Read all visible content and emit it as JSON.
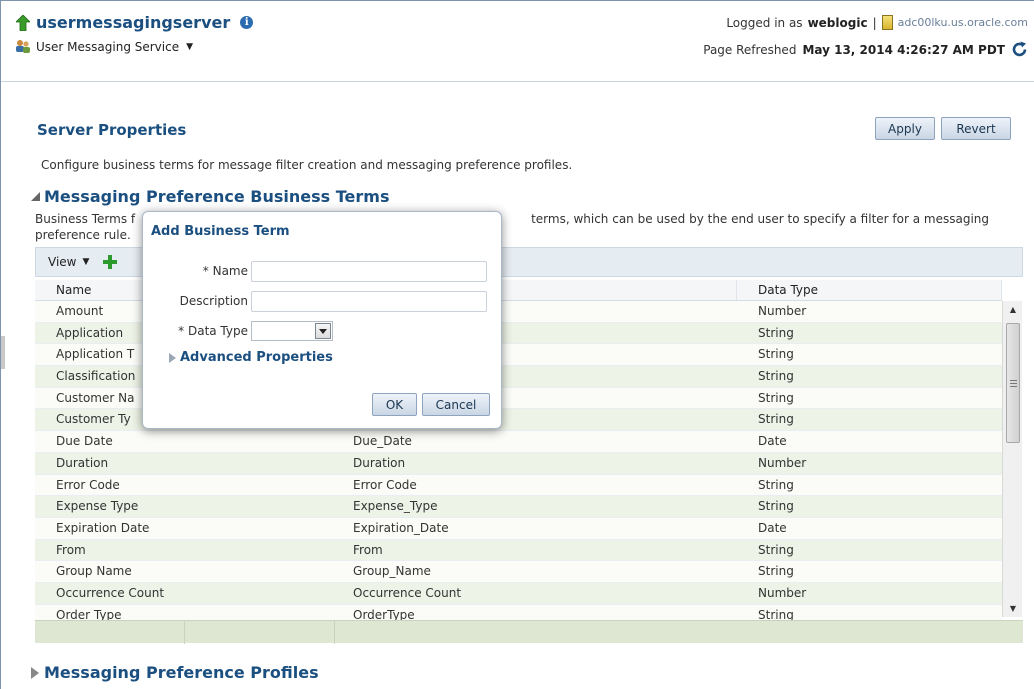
{
  "header": {
    "app_name": "usermessagingserver",
    "menu_label": "User Messaging Service",
    "logged_in_prefix": "Logged in as",
    "user": "weblogic",
    "separator": "|",
    "host": "adc00lku.us.oracle.com",
    "refreshed_prefix": "Page Refreshed",
    "refreshed_time": "May 13, 2014 4:26:27 AM PDT"
  },
  "server_properties": {
    "title": "Server Properties",
    "apply_label": "Apply",
    "revert_label": "Revert",
    "description": "Configure business terms for message filter creation and messaging preference profiles."
  },
  "business_terms": {
    "title": "Messaging Preference Business Terms",
    "description_left": "Business Terms f",
    "description_right": "terms, which can be used by the end user to specify a filter for a messaging",
    "description_line2": "preference rule.",
    "toolbar": {
      "view_label": "View"
    },
    "columns": [
      "Name",
      "",
      "Data Type"
    ],
    "rows": [
      {
        "name": "Amount",
        "key": "",
        "type": "Number"
      },
      {
        "name": "Application",
        "key": "",
        "type": "String"
      },
      {
        "name": "Application T",
        "key": "",
        "type": "String"
      },
      {
        "name": "Classification",
        "key": "",
        "type": "String"
      },
      {
        "name": "Customer Na",
        "key": "",
        "type": "String"
      },
      {
        "name": "Customer Ty",
        "key": "",
        "type": "String"
      },
      {
        "name": "Due Date",
        "key": "Due_Date",
        "type": "Date"
      },
      {
        "name": "Duration",
        "key": "Duration",
        "type": "Number"
      },
      {
        "name": "Error Code",
        "key": "Error Code",
        "type": "String"
      },
      {
        "name": "Expense Type",
        "key": "Expense_Type",
        "type": "String"
      },
      {
        "name": "Expiration Date",
        "key": "Expiration_Date",
        "type": "Date"
      },
      {
        "name": "From",
        "key": "From",
        "type": "String"
      },
      {
        "name": "Group Name",
        "key": "Group_Name",
        "type": "String"
      },
      {
        "name": "Occurrence Count",
        "key": "Occurrence Count",
        "type": "Number"
      },
      {
        "name": "Order Type",
        "key": "OrderType",
        "type": "String"
      }
    ]
  },
  "profiles": {
    "title": "Messaging Preference Profiles"
  },
  "dialog": {
    "title": "Add Business Term",
    "required_marker": "*",
    "name_label": "Name",
    "name_value": "",
    "description_label": "Description",
    "description_value": "",
    "data_type_label": "Data Type",
    "data_type_value": "",
    "advanced_label": "Advanced Properties",
    "ok_label": "OK",
    "cancel_label": "Cancel"
  }
}
